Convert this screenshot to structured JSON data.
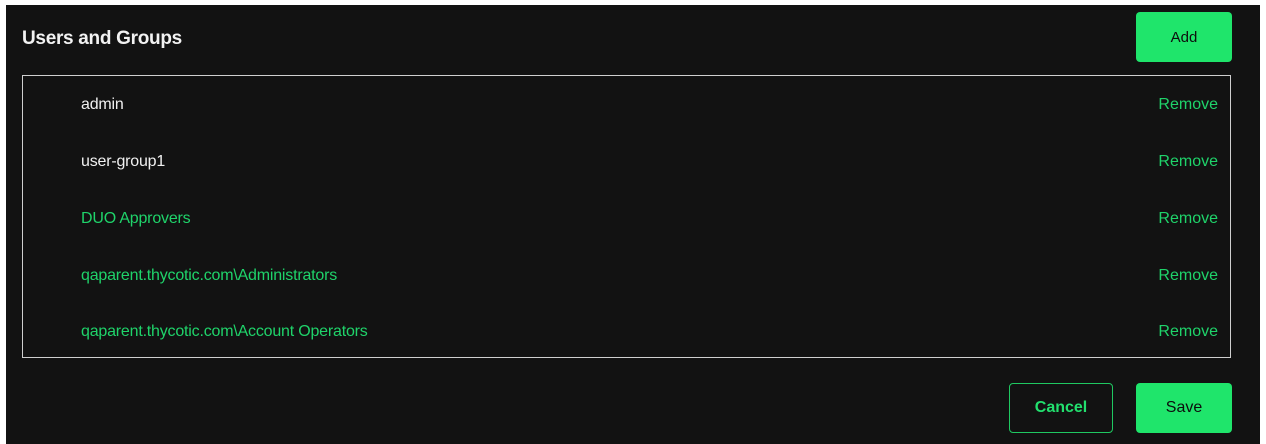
{
  "header": {
    "title": "Users and Groups",
    "add_label": "Add"
  },
  "members": [
    {
      "name": "admin",
      "style": "plain",
      "remove_label": "Remove"
    },
    {
      "name": "user-group1",
      "style": "plain",
      "remove_label": "Remove"
    },
    {
      "name": "DUO Approvers",
      "style": "link",
      "remove_label": "Remove"
    },
    {
      "name": "qaparent.thycotic.com\\Administrators",
      "style": "link",
      "remove_label": "Remove"
    },
    {
      "name": "qaparent.thycotic.com\\Account Operators",
      "style": "link",
      "remove_label": "Remove"
    }
  ],
  "footer": {
    "cancel_label": "Cancel",
    "save_label": "Save"
  },
  "colors": {
    "background": "#121212",
    "accent": "#1fe56b",
    "link": "#1fd36a",
    "text": "#f0f0f0",
    "border": "#cfcfcf"
  }
}
